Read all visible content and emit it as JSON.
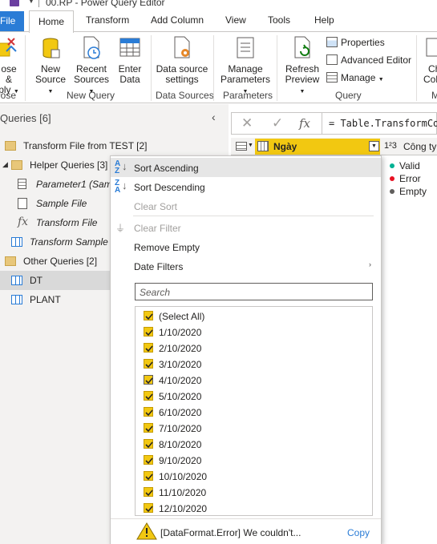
{
  "window": {
    "title": "00.RP - Power Query Editor"
  },
  "tabs": [
    "File",
    "Home",
    "Transform",
    "Add Column",
    "View",
    "Tools",
    "Help"
  ],
  "ribbon": {
    "close_apply": [
      "ose &",
      "ply"
    ],
    "close_group": "lose",
    "new_source": [
      "New",
      "Source"
    ],
    "recent_sources": [
      "Recent",
      "Sources"
    ],
    "enter_data": [
      "Enter",
      "Data"
    ],
    "new_query_group": "New Query",
    "data_source_settings": [
      "Data source",
      "settings"
    ],
    "data_sources_group": "Data Sources",
    "manage_parameters": [
      "Manage",
      "Parameters"
    ],
    "parameters_group": "Parameters",
    "refresh_preview": [
      "Refresh",
      "Preview"
    ],
    "properties": "Properties",
    "advanced_editor": "Advanced Editor",
    "manage": "Manage",
    "query_group": "Query",
    "choose_columns": [
      "Ch",
      "Col"
    ],
    "manage_columns_group": "M"
  },
  "queries": {
    "header": "Queries [6]",
    "items": [
      {
        "label": "Transform File from TEST [2]"
      },
      {
        "label": "Helper Queries [3]"
      },
      {
        "label": "Parameter1 (Sam"
      },
      {
        "label": "Sample File"
      },
      {
        "label": "Transform File"
      },
      {
        "label": "Transform Sample"
      },
      {
        "label": "Other Queries [2]"
      },
      {
        "label": "DT"
      },
      {
        "label": "PLANT"
      }
    ]
  },
  "formula": {
    "text": "= Table.TransformColu",
    "fx": "fx"
  },
  "grid": {
    "col1": "Ngày",
    "col2_type": "1²3",
    "col2": "Công ty",
    "quality": [
      "Valid",
      "Error",
      "Empty"
    ]
  },
  "menu": {
    "sort_asc": "Sort Ascending",
    "sort_desc": "Sort Descending",
    "clear_sort": "Clear Sort",
    "clear_filter": "Clear Filter",
    "remove_empty": "Remove Empty",
    "date_filters": "Date Filters",
    "search_placeholder": "Search",
    "filter_items": [
      "(Select All)",
      "1/10/2020",
      "2/10/2020",
      "3/10/2020",
      "4/10/2020",
      "5/10/2020",
      "6/10/2020",
      "7/10/2020",
      "8/10/2020",
      "9/10/2020",
      "10/10/2020",
      "11/10/2020",
      "12/10/2020"
    ],
    "error_text": "[DataFormat.Error] We couldn't...",
    "copy": "Copy"
  },
  "colors": {
    "accent": "#f2c811",
    "file_tab": "#2a7cd6",
    "valid": "#00b294",
    "error": "#e81123",
    "empty": "#605e5c"
  }
}
